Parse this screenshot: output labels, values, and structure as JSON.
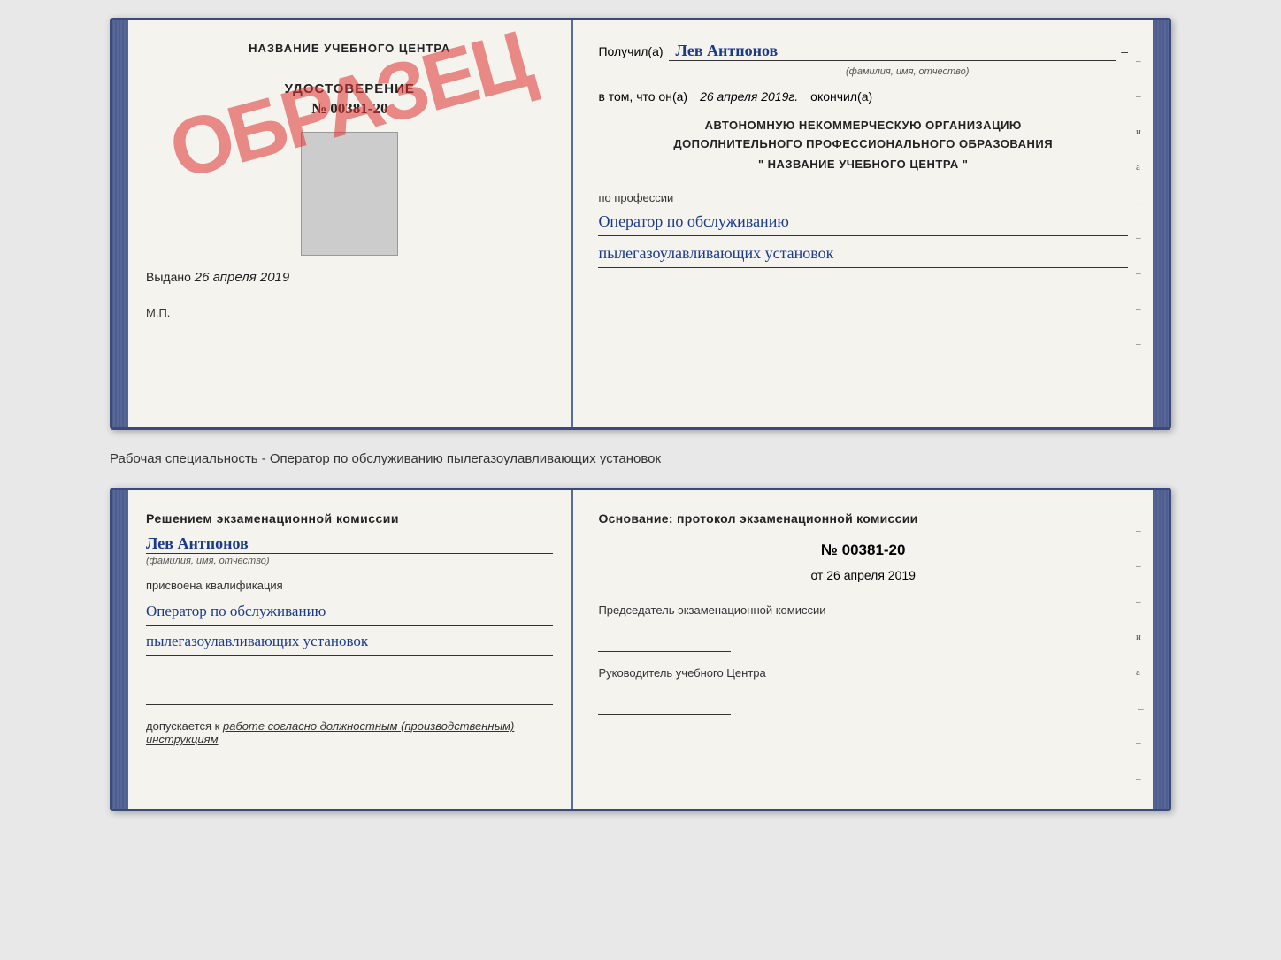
{
  "page": {
    "background_color": "#e8e8e8"
  },
  "top_certificate": {
    "left_page": {
      "title": "НАЗВАНИЕ УЧЕБНОГО ЦЕНТРА",
      "obrazec": "ОБРАЗЕЦ",
      "udostoverenie_label": "УДОСТОВЕРЕНИЕ",
      "udostoverenie_number": "№ 00381-20",
      "vydano_prefix": "Выдано",
      "vydano_date": "26 апреля 2019",
      "mp_label": "М.П."
    },
    "right_page": {
      "received_prefix": "Получил(а)",
      "received_name": "Лев Антпонов",
      "received_subtitle": "(фамилия, имя, отчество)",
      "received_dash": "–",
      "date_prefix": "в том, что он(а)",
      "date_value": "26 апреля 2019г.",
      "date_suffix": "окончил(а)",
      "org_line1": "АВТОНОМНУЮ НЕКОММЕРЧЕСКУЮ ОРГАНИЗАЦИЮ",
      "org_line2": "ДОПОЛНИТЕЛЬНОГО ПРОФЕССИОНАЛЬНОГО ОБРАЗОВАНИЯ",
      "org_name": "НАЗВАНИЕ УЧЕБНОГО ЦЕНТРА",
      "org_quotes_open": "\"",
      "org_quotes_close": "\"",
      "profession_label": "по профессии",
      "profession_line1": "Оператор по обслуживанию",
      "profession_line2": "пылегазоулавливающих установок",
      "side_marks": [
        "–",
        "–",
        "и",
        "а",
        "←",
        "–",
        "–",
        "–",
        "–"
      ]
    }
  },
  "middle_text": "Рабочая специальность - Оператор по обслуживанию пылегазоулавливающих установок",
  "bottom_certificate": {
    "left_page": {
      "decision_title": "Решением экзаменационной комиссии",
      "person_name": "Лев Антпонов",
      "person_subtitle": "(фамилия, имя, отчество)",
      "assigned_label": "присвоена квалификация",
      "qual_line1": "Оператор по обслуживанию",
      "qual_line2": "пылегазоулавливающих установок",
      "dopuskaetsya_prefix": "допускается к",
      "dopuskaetsya_value": "работе согласно должностным (производственным) инструкциям"
    },
    "right_page": {
      "osnovaniye_title": "Основание: протокол экзаменационной комиссии",
      "protocol_number": "№ 00381-20",
      "protocol_date_prefix": "от",
      "protocol_date": "26 апреля 2019",
      "chairman_label": "Председатель экзаменационной комиссии",
      "director_label": "Руководитель учебного Центра",
      "side_marks": [
        "–",
        "–",
        "–",
        "и",
        "а",
        "←",
        "–",
        "–",
        "–",
        "–"
      ]
    }
  }
}
